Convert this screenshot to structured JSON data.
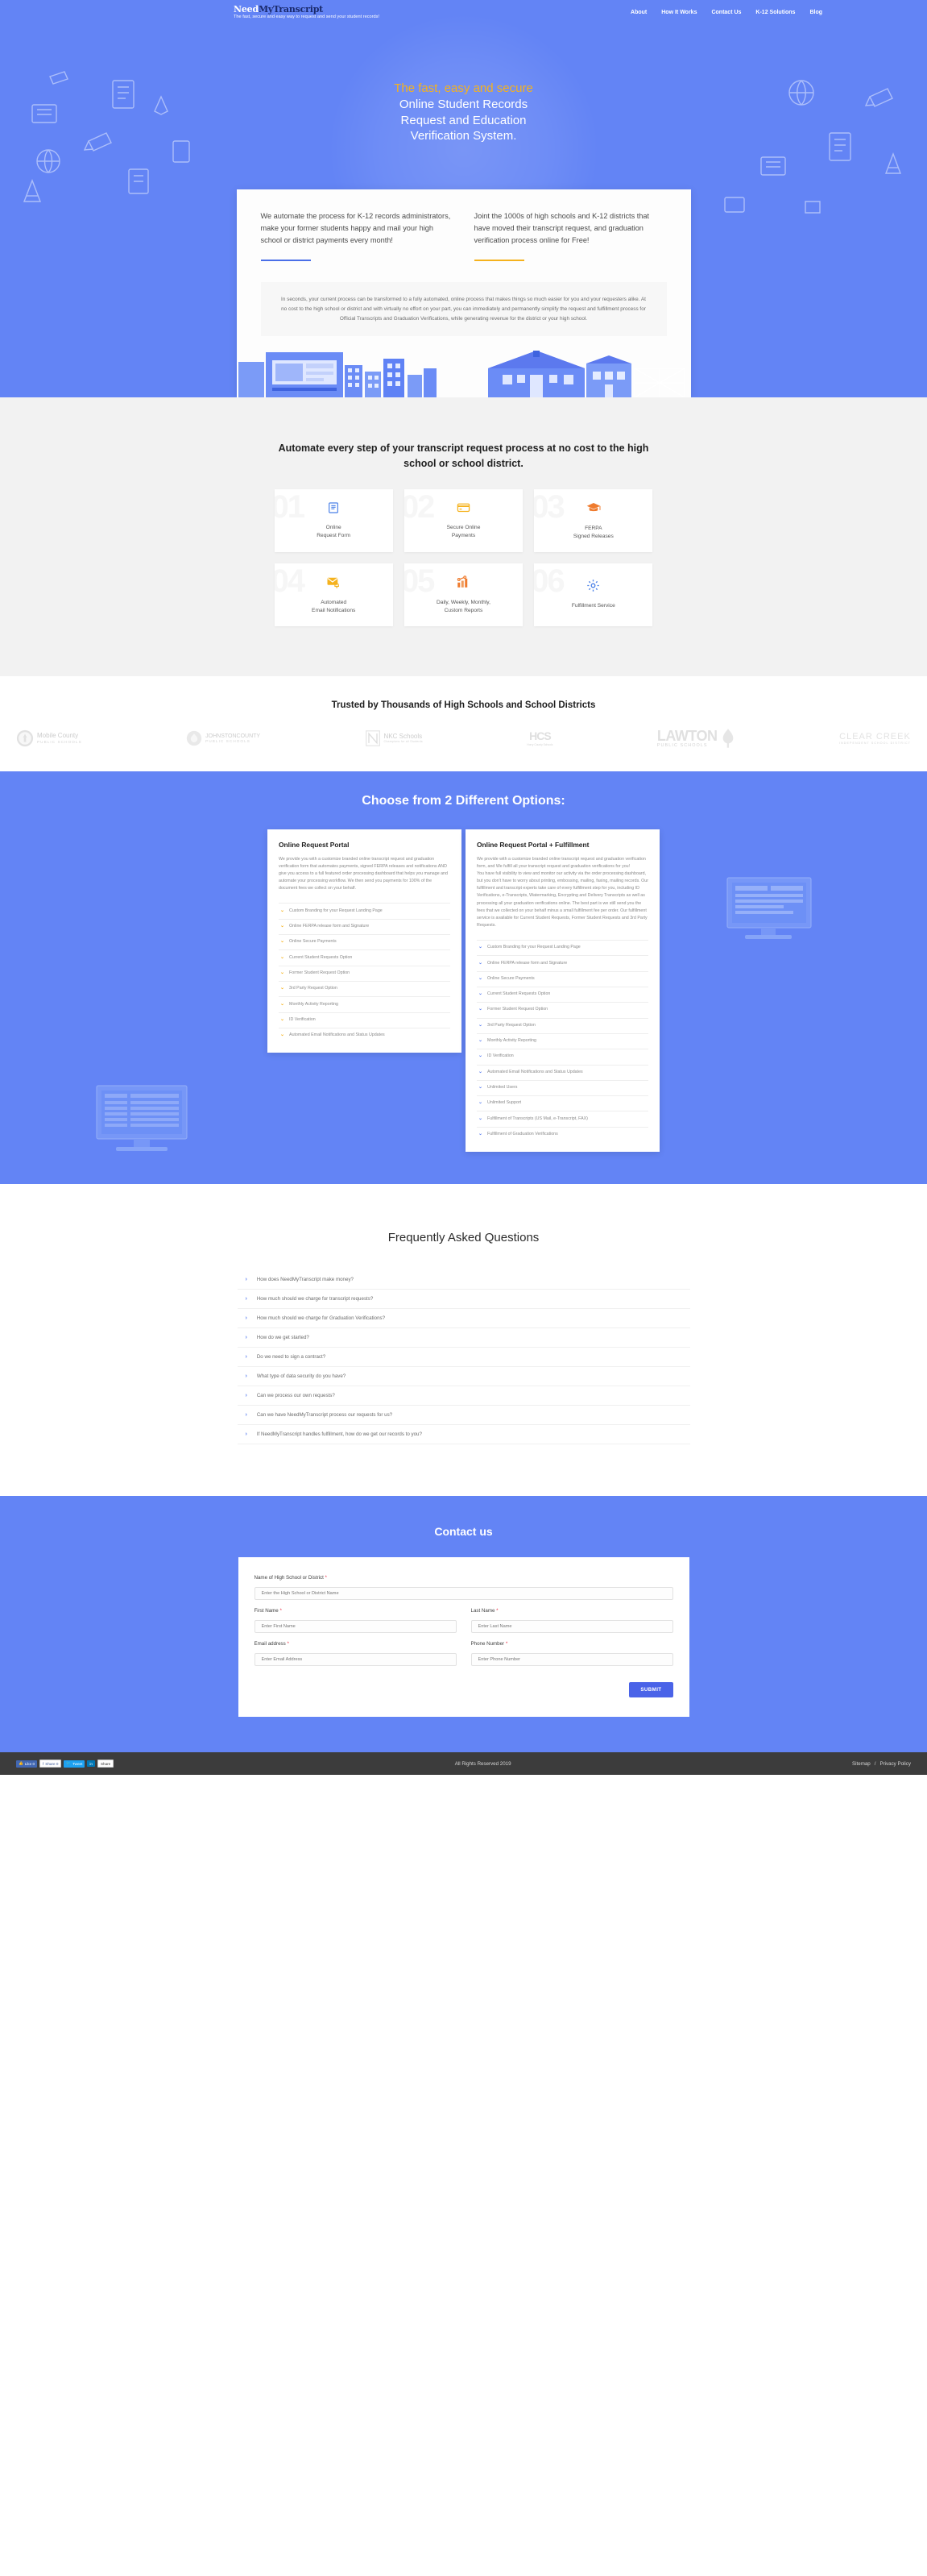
{
  "brand": {
    "name_part1": "Need",
    "name_part2": "MyTranscript",
    "tagline": "The fast, secure and easy way to request and send your student records!"
  },
  "nav": {
    "items": [
      {
        "label": "About"
      },
      {
        "label": "How It Works"
      },
      {
        "label": "Contact Us"
      },
      {
        "label": "K-12 Solutions"
      },
      {
        "label": "Blog"
      }
    ]
  },
  "hero": {
    "accent_line": "The fast, easy and secure",
    "title_line1": "Online Student Records",
    "title_line2": "Request and Education",
    "title_line3": "Verification System."
  },
  "intro_card": {
    "left_text": "We automate the process for K-12 records administrators, make your former students happy and mail your high school or district payments every month!",
    "right_text": "Joint the 1000s of high schools and K-12 districts that have moved their transcript request, and graduation verification process online for Free!",
    "note": "In seconds, your current process can be transformed to a fully automated, online process that makes things so much easier for you and your requesters alike. At no cost to the high school or district and with virtually no effort on your part, you can immediately and permanently simplify the request and fulfillment process for Official Transcripts and Graduation Verifications, while generating revenue for the district or your high school."
  },
  "features": {
    "heading": "Automate every step of your transcript request process at no cost to the high school or school district.",
    "cards": [
      {
        "number": "01",
        "icon": "document-icon",
        "label_line1": "Online",
        "label_line2": "Request Form",
        "color": "#4a80e8"
      },
      {
        "number": "02",
        "icon": "credit-card-icon",
        "label_line1": "Secure Online",
        "label_line2": "Payments",
        "color": "#f5b21d"
      },
      {
        "number": "03",
        "icon": "graduation-cap-icon",
        "label_line1": "FERPA",
        "label_line2": "Signed Releases",
        "color": "#ef7b2e"
      },
      {
        "number": "04",
        "icon": "email-bell-icon",
        "label_line1": "Automated",
        "label_line2": "Email Notifications",
        "color": "#f5b21d"
      },
      {
        "number": "05",
        "icon": "bar-chart-icon",
        "label_line1": "Daily, Weekly, Monthly,",
        "label_line2": "Custom Reports",
        "color": "#ef7b2e"
      },
      {
        "number": "06",
        "icon": "gear-icon",
        "label_line1": "Fulfillment Service",
        "label_line2": "",
        "color": "#4a80e8"
      }
    ]
  },
  "trusted": {
    "heading": "Trusted by Thousands of High Schools and School Districts",
    "logos": [
      {
        "name": "Mobile County",
        "sub": "PUBLIC SCHOOLS"
      },
      {
        "name": "JOHNSTONCOUNTY",
        "sub": "PUBLIC SCHOOLS"
      },
      {
        "name": "NKC Schools",
        "sub": "Champions for all Students"
      },
      {
        "name": "HCS",
        "sub": "Horry County Schools"
      },
      {
        "name": "LAWTON",
        "sub": "PUBLIC SCHOOLS"
      },
      {
        "name": "CLEAR CREEK",
        "sub": "INDEPENDENT SCHOOL DISTRICT"
      }
    ]
  },
  "options": {
    "heading": "Choose from 2 Different Options:",
    "left": {
      "title": "Online Request Portal",
      "description": "We provide you with a customize branded online transcript request and graduation verification form that automates payments, signed FERPA releases and notifications AND give you access to a full featured order processing dashboard that helps you manage and automate your processing workflow. We then send you payments for 100% of the document fees we collect on your behalf.",
      "items": [
        "Custom Branding for your Request Landing Page",
        "Online FERPA release form and Signature",
        "Online Secure Payments",
        "Current Student Requests Option",
        "Former Student Request Option",
        "3rd Party Request Option",
        "Monthly Activity Reporting",
        "ID Verification",
        "Automated Email Notifications and Status Updates"
      ]
    },
    "right": {
      "title": "Online Request Portal + Fulfillment",
      "description_p1": "We provide with a customize branded online transcript request and graduation verification form, and We fulfill all your transcript request and graduation verifications for you!",
      "description_p2": "You have full visibility to view and monitor our activity via the order processing dashboard, but you don't have to worry about printing, embossing, mailing, faxing, mailing records. Our fulfillment and transcript experts take care of every fulfillment step for you, including ID Verifications, e-Transcripts, Watermarking, Encrypting and Delivery Transcripts as well as processing all your graduation verifications online. The best part is we still send you the fees that we collected on your behalf minus a small fulfillment fee per order. Our fulfillment service is available for Current Student Requests, Former Student Requests and 3rd Party Requests.",
      "items": [
        "Custom Branding for your Request Landing Page",
        "Online FERPA release form and Signature",
        "Online Secure Payments",
        "Current Student Requests Option",
        "Former Student Request Option",
        "3rd Party Request Option",
        "Monthly Activity Reporting",
        "ID Verification",
        "Automated Email Notifications and Status Updates",
        "Unlimited Users",
        "Unlimited Support",
        "Fulfillment of Transcripts (US Mail, e-Transcript, FAX)",
        "Fulfillment of Graduation Verifications"
      ]
    }
  },
  "faq": {
    "heading": "Frequently Asked Questions",
    "items": [
      "How does NeedMyTranscript make money?",
      "How much should we charge for transcript requests?",
      "How much should we charge for Graduation Verifications?",
      "How do we get started?",
      "Do we need to sign a contract?",
      "What type of data security do you have?",
      "Can we process our own requests?",
      "Can we have NeedMyTranscript process our requests for us?",
      "If NeedMyTranscript handles fulfillment, how do we get our records to you?"
    ]
  },
  "contact": {
    "heading": "Contact us",
    "fields": {
      "school": {
        "label": "Name of High School or District",
        "placeholder": "Enter the High School or District Name",
        "value": ""
      },
      "first_name": {
        "label": "First Name",
        "placeholder": "Enter First Name",
        "value": ""
      },
      "last_name": {
        "label": "Last Name",
        "placeholder": "Enter Last Name",
        "value": ""
      },
      "email": {
        "label": "Email address",
        "placeholder": "Enter Email Address",
        "value": ""
      },
      "phone": {
        "label": "Phone Number",
        "placeholder": "Enter Phone Number",
        "value": ""
      }
    },
    "submit_label": "SUBMIT"
  },
  "footer": {
    "social": [
      {
        "name": "facebook-like-button",
        "label": "Like 0"
      },
      {
        "name": "facebook-share-button",
        "label": "Share 0"
      },
      {
        "name": "twitter-tweet-button",
        "label": "Tweet"
      },
      {
        "name": "linkedin-share-button",
        "label": "Share"
      }
    ],
    "copyright": "All Rights Reserved 2019",
    "sitemap": "Sitemap",
    "separator": "/",
    "privacy": "Privacy Policy"
  },
  "colors": {
    "brand_blue": "#6384f5",
    "accent_gold": "#f5b21d",
    "accent_orange": "#ef7b2e",
    "link_blue": "#5b7ff0",
    "footer_dark": "#3c3c3c"
  }
}
